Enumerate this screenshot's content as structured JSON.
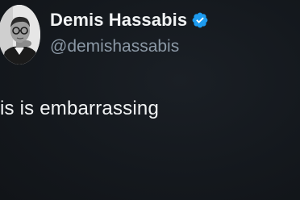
{
  "author": {
    "display_name": "Demis Hassabis",
    "handle": "@demishassabis",
    "verified": true,
    "verified_badge_color": "#1d9bf0",
    "avatar_icon": "profile-photo"
  },
  "post": {
    "text": "is is embarrassing"
  },
  "colors": {
    "background": "#15191e",
    "primary_text": "#f1f3f4",
    "secondary_text": "#8b98a5"
  }
}
